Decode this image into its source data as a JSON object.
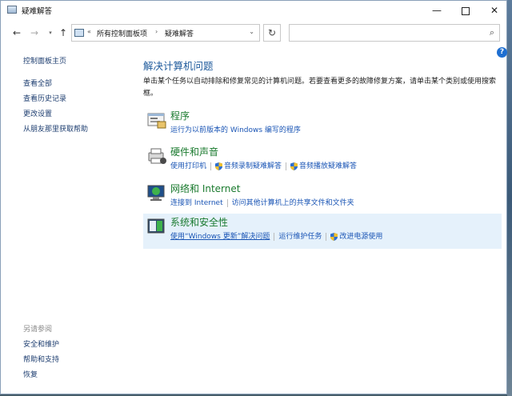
{
  "window": {
    "title": "疑难解答"
  },
  "address": {
    "back_chevron": "«",
    "crumb1": "所有控制面板项",
    "separator": "›",
    "crumb2": "疑难解答"
  },
  "search": {
    "placeholder": ""
  },
  "sidebar": {
    "links": [
      "控制面板主页",
      "查看全部",
      "查看历史记录",
      "更改设置",
      "从朋友那里获取帮助"
    ],
    "see_also_label": "另请参阅",
    "see_also": [
      "安全和维护",
      "帮助和支持",
      "恢复"
    ]
  },
  "main": {
    "title": "解决计算机问题",
    "description": "单击某个任务以自动排除和修复常见的计算机问题。若要查看更多的故障修复方案，请单击某个类别或使用搜索框。"
  },
  "categories": [
    {
      "title": "程序",
      "icon": "programs-icon",
      "links": [
        {
          "label": "运行为以前版本的 Windows 编写的程序",
          "shield": false
        }
      ]
    },
    {
      "title": "硬件和声音",
      "icon": "hardware-sound-icon",
      "links": [
        {
          "label": "使用打印机",
          "shield": false
        },
        {
          "label": "音频录制疑难解答",
          "shield": true
        },
        {
          "label": "音频播放疑难解答",
          "shield": true
        }
      ]
    },
    {
      "title": "网络和 Internet",
      "icon": "network-icon",
      "links": [
        {
          "label": "连接到 Internet",
          "shield": false
        },
        {
          "label": "访问其他计算机上的共享文件和文件夹",
          "shield": false
        }
      ]
    },
    {
      "title": "系统和安全性",
      "icon": "system-security-icon",
      "selected": true,
      "links": [
        {
          "label": "使用“Windows 更新”解决问题",
          "shield": false,
          "underline": true
        },
        {
          "label": "运行维护任务",
          "shield": false
        },
        {
          "label": "改进电源使用",
          "shield": true
        }
      ]
    }
  ],
  "colors": {
    "link": "#1a55b5",
    "category_title": "#1a7a2e",
    "heading": "#1e5a9c",
    "selected_bg": "#e5f1fb"
  }
}
